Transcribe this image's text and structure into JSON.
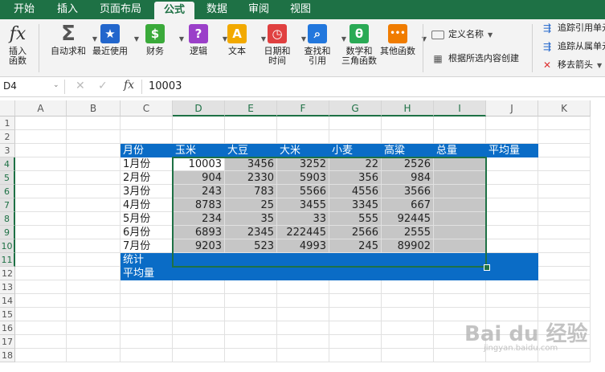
{
  "tabs": [
    "开始",
    "插入",
    "页面布局",
    "公式",
    "数据",
    "审阅",
    "视图"
  ],
  "active_tab": "公式",
  "ribbon": {
    "insert_function": "插入\n函数",
    "buttons": [
      {
        "label": "自动求和",
        "icon": "sigma-icon",
        "glyph": "Σ",
        "color": "#555555"
      },
      {
        "label": "最近使用",
        "icon": "star-icon",
        "glyph": "★",
        "color": "#2266cc"
      },
      {
        "label": "财务",
        "icon": "coins-icon",
        "glyph": "$",
        "color": "#3aaa3a"
      },
      {
        "label": "逻辑",
        "icon": "question-icon",
        "glyph": "?",
        "color": "#9b3fc9"
      },
      {
        "label": "文本",
        "icon": "text-a-icon",
        "glyph": "A",
        "color": "#f2a900"
      },
      {
        "label": "日期和\n时间",
        "icon": "clock-icon",
        "glyph": "◷",
        "color": "#e04040"
      },
      {
        "label": "查找和\n引用",
        "icon": "magnifier-icon",
        "glyph": "⌕",
        "color": "#2277dd"
      },
      {
        "label": "数学和\n三角函数",
        "icon": "theta-icon",
        "glyph": "θ",
        "color": "#2aaa55"
      },
      {
        "label": "其他函数",
        "icon": "more-icon",
        "glyph": "•••",
        "color": "#f07c00"
      }
    ],
    "define_name": "定义名称",
    "create_from_selection": "根据所选内容创建",
    "trace_precedents": "追踪引用单元",
    "trace_dependents": "追踪从属单元",
    "remove_arrows": "移去箭头"
  },
  "formula_bar": {
    "name_box": "D4",
    "fx": "fx",
    "value": "10003"
  },
  "columns": [
    "A",
    "B",
    "C",
    "D",
    "E",
    "F",
    "G",
    "H",
    "I",
    "J",
    "K"
  ],
  "rows": [
    "1",
    "2",
    "3",
    "4",
    "5",
    "6",
    "7",
    "8",
    "9",
    "10",
    "11",
    "12",
    "13",
    "14",
    "15",
    "16",
    "17",
    "18"
  ],
  "sheet": {
    "header": [
      "月份",
      "玉米",
      "大豆",
      "大米",
      "小麦",
      "高粱",
      "总量",
      "平均量"
    ],
    "months": [
      "1月份",
      "2月份",
      "3月份",
      "4月份",
      "5月份",
      "6月份",
      "7月份"
    ],
    "values": [
      [
        "10003",
        "3456",
        "3252",
        "22",
        "2526"
      ],
      [
        "904",
        "2330",
        "5903",
        "356",
        "984"
      ],
      [
        "243",
        "783",
        "5566",
        "4556",
        "3566"
      ],
      [
        "8783",
        "25",
        "3455",
        "3345",
        "667"
      ],
      [
        "234",
        "35",
        "33",
        "555",
        "92445"
      ],
      [
        "6893",
        "2345",
        "222445",
        "2566",
        "2555"
      ],
      [
        "9203",
        "523",
        "4993",
        "245",
        "89902"
      ]
    ],
    "stats_label": "统计",
    "avg_label": "平均量"
  },
  "watermark": "Bai du 经验",
  "watermark_url": "jingyan.baidu.com"
}
